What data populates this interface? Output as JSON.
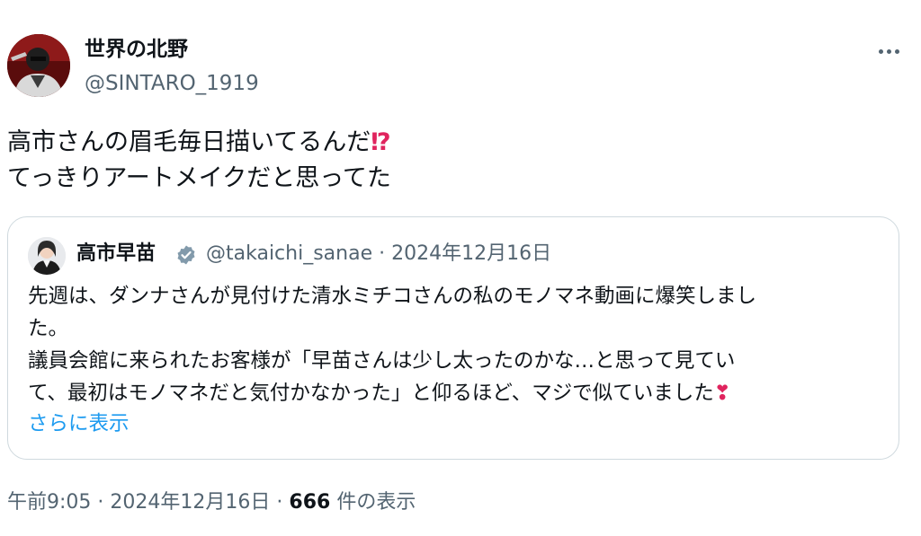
{
  "author": {
    "display_name": "世界の北野",
    "handle": "@SINTARO_1919"
  },
  "more_icon": "more-horizontal-icon",
  "tweet": {
    "line1": "高市さんの眉毛毎日描いてるんだ",
    "line1_emoji": "⁉",
    "line2": "てっきりアートメイクだと思ってた"
  },
  "quote": {
    "display_name": "高市早苗",
    "verified_icon": "verified-badge-icon",
    "verified_color": "#829aab",
    "handle": "@takaichi_sanae",
    "separator": "·",
    "date": "2024年12月16日",
    "lines": [
      "先週は、ダンナさんが見付けた清水ミチコさんの私のモノマネ動画に爆笑しまし",
      "た。",
      "議員会館に来られたお客様が「早苗さんは少し太ったのかな…と思って見てい",
      "て、最初はモノマネだと気付かなかった」と仰るほど、マジで似ていました"
    ],
    "heart": "❣",
    "show_more": "さらに表示"
  },
  "footer": {
    "time": "午前9:05",
    "sep1": "·",
    "date": "2024年12月16日",
    "sep2": "·",
    "view_count": "666",
    "view_label": "件の表示"
  },
  "colors": {
    "text": "#0f1419",
    "secondary": "#536471",
    "link": "#1d9bf0",
    "border": "#cfd9de",
    "emoji_red": "#e0245e"
  }
}
